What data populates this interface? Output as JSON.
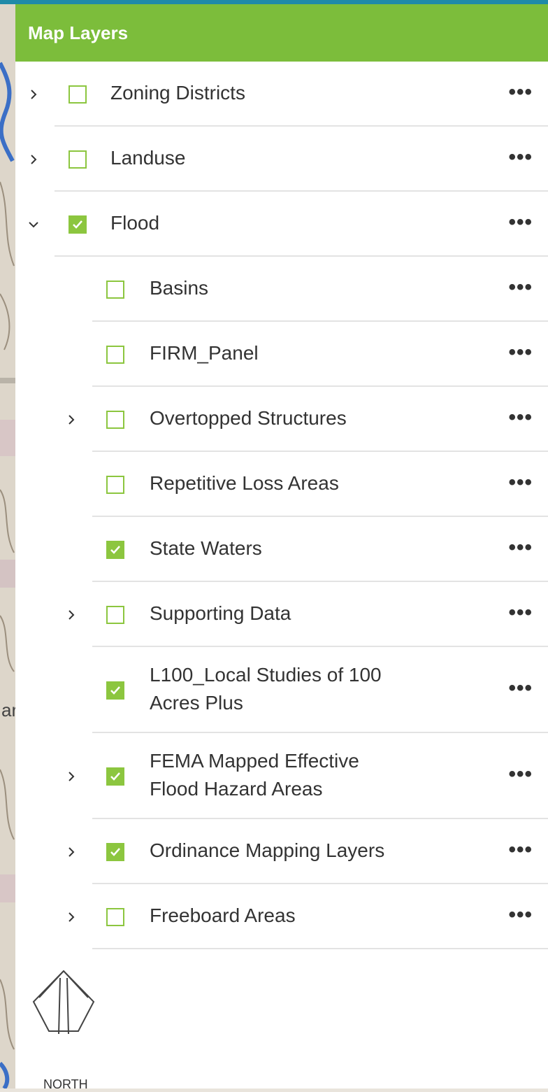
{
  "colors": {
    "accent": "#8cc63f",
    "topbar": "#1f8aa8",
    "header_bg": "#7cbd3b"
  },
  "header": {
    "title": "Map Layers"
  },
  "map": {
    "edge_text": "ar"
  },
  "north_arrow": {
    "label": "NORTH",
    "icon": "north-arrow-icon"
  },
  "layers": [
    {
      "label": "Zoning Districts",
      "level": 0,
      "expand": "collapsed",
      "checked": false
    },
    {
      "label": "Landuse",
      "level": 0,
      "expand": "collapsed",
      "checked": false
    },
    {
      "label": "Flood",
      "level": 0,
      "expand": "expanded",
      "checked": true
    },
    {
      "label": "Basins",
      "level": 1,
      "expand": "none",
      "checked": false
    },
    {
      "label": "FIRM_Panel",
      "level": 1,
      "expand": "none",
      "checked": false
    },
    {
      "label": "Overtopped Structures",
      "level": 1,
      "expand": "collapsed",
      "checked": false
    },
    {
      "label": "Repetitive Loss Areas",
      "level": 1,
      "expand": "none",
      "checked": false
    },
    {
      "label": "State Waters",
      "level": 1,
      "expand": "none",
      "checked": true
    },
    {
      "label": "Supporting Data",
      "level": 1,
      "expand": "collapsed",
      "checked": false
    },
    {
      "label": "L100_Local Studies of 100\nAcres Plus",
      "level": 1,
      "expand": "none",
      "checked": true
    },
    {
      "label": "FEMA Mapped Effective\nFlood Hazard Areas",
      "level": 1,
      "expand": "collapsed",
      "checked": true
    },
    {
      "label": "Ordinance Mapping Layers",
      "level": 1,
      "expand": "collapsed",
      "checked": true
    },
    {
      "label": "Freeboard Areas",
      "level": 1,
      "expand": "collapsed",
      "checked": false
    }
  ],
  "menu_glyph": "•••"
}
